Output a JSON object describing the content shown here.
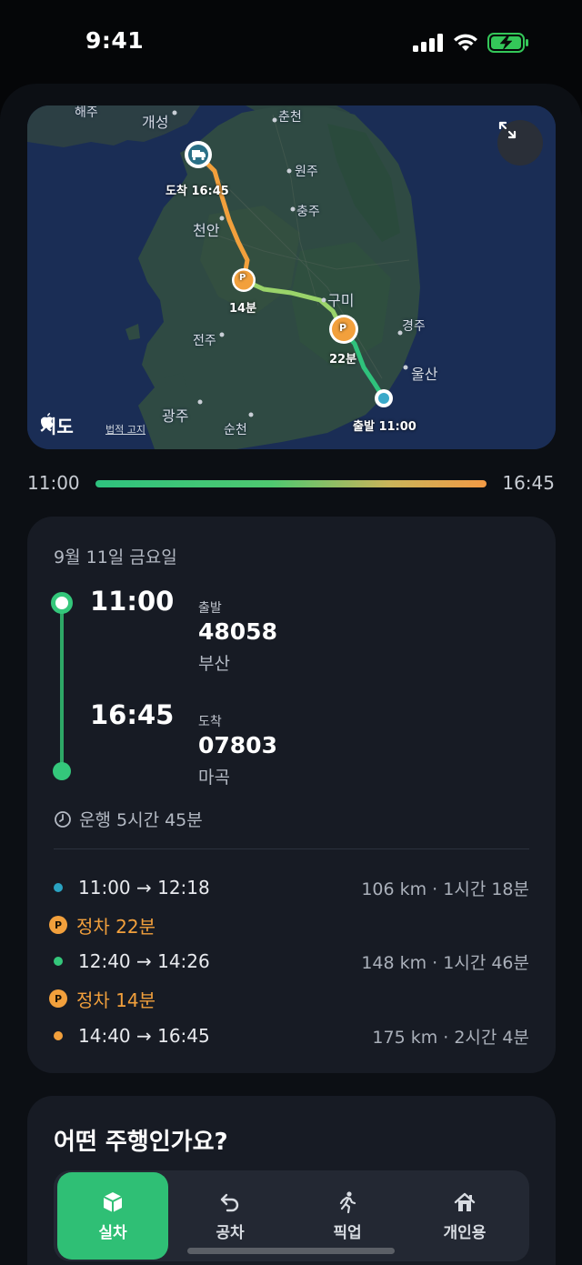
{
  "status": {
    "time": "9:41"
  },
  "map": {
    "labels": {
      "haeju": "해주",
      "gaeseong": "개성",
      "chuncheon": "춘천",
      "wonju": "원주",
      "chungju": "충주",
      "cheonan": "천안",
      "gumi": "구미",
      "gyeongju": "경주",
      "ulsan": "울산",
      "jeonju": "전주",
      "gwangju": "광주",
      "suncheon": "순천"
    },
    "arrival_label": "도착 16:45",
    "departure_label": "출발 11:00",
    "stop1_label": "14분",
    "stop2_label": "22분",
    "parking_letter": "P",
    "brand": "지도",
    "legal": "법적 고지",
    "colors": {
      "route_orange": "#f2a03c",
      "route_green": "#8fd46b",
      "route_teal": "#2fc27c"
    }
  },
  "timeline": {
    "start": "11:00",
    "end": "16:45"
  },
  "trip": {
    "date": "9월 11일 금요일",
    "departure": {
      "time": "11:00",
      "kind": "출발",
      "code": "48058",
      "place": "부산"
    },
    "arrival": {
      "time": "16:45",
      "kind": "도착",
      "code": "07803",
      "place": "마곡"
    },
    "duration": "운행 5시간 45분",
    "segments": [
      {
        "time": "11:00 → 12:18",
        "info": "106 km · 1시간 18분",
        "color": "#2aa3c2"
      },
      {
        "time": "12:40 → 14:26",
        "info": "148 km · 1시간 46분",
        "color": "#34c77b"
      },
      {
        "time": "14:40 → 16:45",
        "info": "175 km · 2시간 4분",
        "color": "#f2a03c"
      }
    ],
    "stops": [
      {
        "letter": "P",
        "label": "정차 22분"
      },
      {
        "letter": "P",
        "label": "정차 14분"
      }
    ]
  },
  "question": {
    "title": "어떤 주행인가요?",
    "options": [
      {
        "label": "실차",
        "icon": "package-icon",
        "active": true
      },
      {
        "label": "공차",
        "icon": "return-arrow-icon",
        "active": false
      },
      {
        "label": "픽업",
        "icon": "running-person-icon",
        "active": false
      },
      {
        "label": "개인용",
        "icon": "home-icon",
        "active": false
      }
    ]
  }
}
